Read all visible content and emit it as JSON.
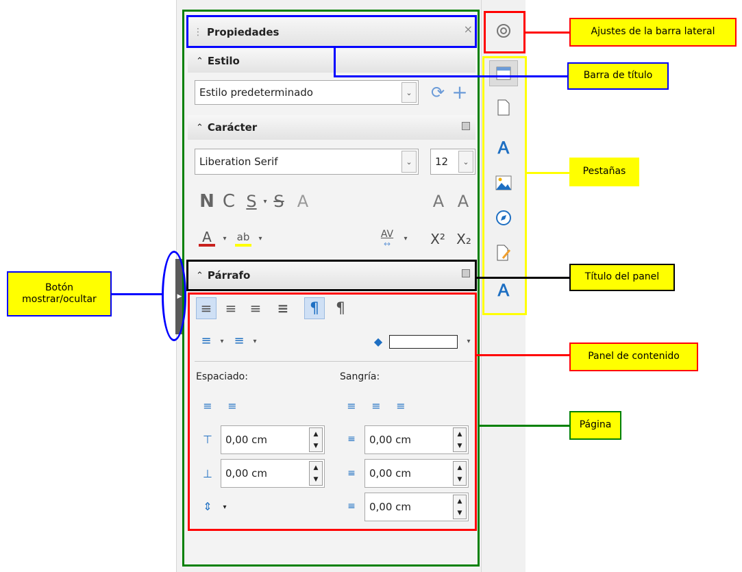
{
  "sidebar": {
    "title": "Propiedades",
    "close_glyph": "×",
    "sections": {
      "estilo": {
        "title": "Estilo",
        "style_value": "Estilo predeterminado"
      },
      "caracter": {
        "title": "Carácter",
        "font_name": "Liberation Serif",
        "font_size": "12",
        "bold_label": "N",
        "italic_label": "C",
        "underline_label": "S",
        "strike_label": "S",
        "shadow_label": "A",
        "grow_label": "A",
        "shrink_label": "A",
        "font_color_label": "A",
        "highlight_label": "ab",
        "spacing_label": "AV",
        "superscript_label": "X²",
        "subscript_label": "X₂"
      },
      "parrafo": {
        "title": "Párrafo",
        "spacing_label": "Espaciado:",
        "indent_label": "Sangría:",
        "above_value": "0,00 cm",
        "below_value": "0,00 cm",
        "before_text_value": "0,00 cm",
        "after_text_value": "0,00 cm",
        "first_line_value": "0,00 cm"
      }
    }
  },
  "tabs": [
    "gear-icon",
    "properties-icon",
    "page-icon",
    "styles-icon",
    "gallery-icon",
    "navigator-icon",
    "manage-changes-icon",
    "design-icon"
  ],
  "annotations": {
    "settings": "Ajustes de la barra lateral",
    "titlebar": "Barra de título",
    "tabs": "Pestañas",
    "panel_title": "Título del panel",
    "content": "Panel de contenido",
    "page": "Página",
    "toggle": "Botón mostrar/ocultar"
  },
  "colors": {
    "red": "#ff0000",
    "blue": "#0000ff",
    "green": "#008000",
    "yellow": "#ffff00",
    "black": "#000000",
    "accent_blue": "#1e6fc2"
  }
}
